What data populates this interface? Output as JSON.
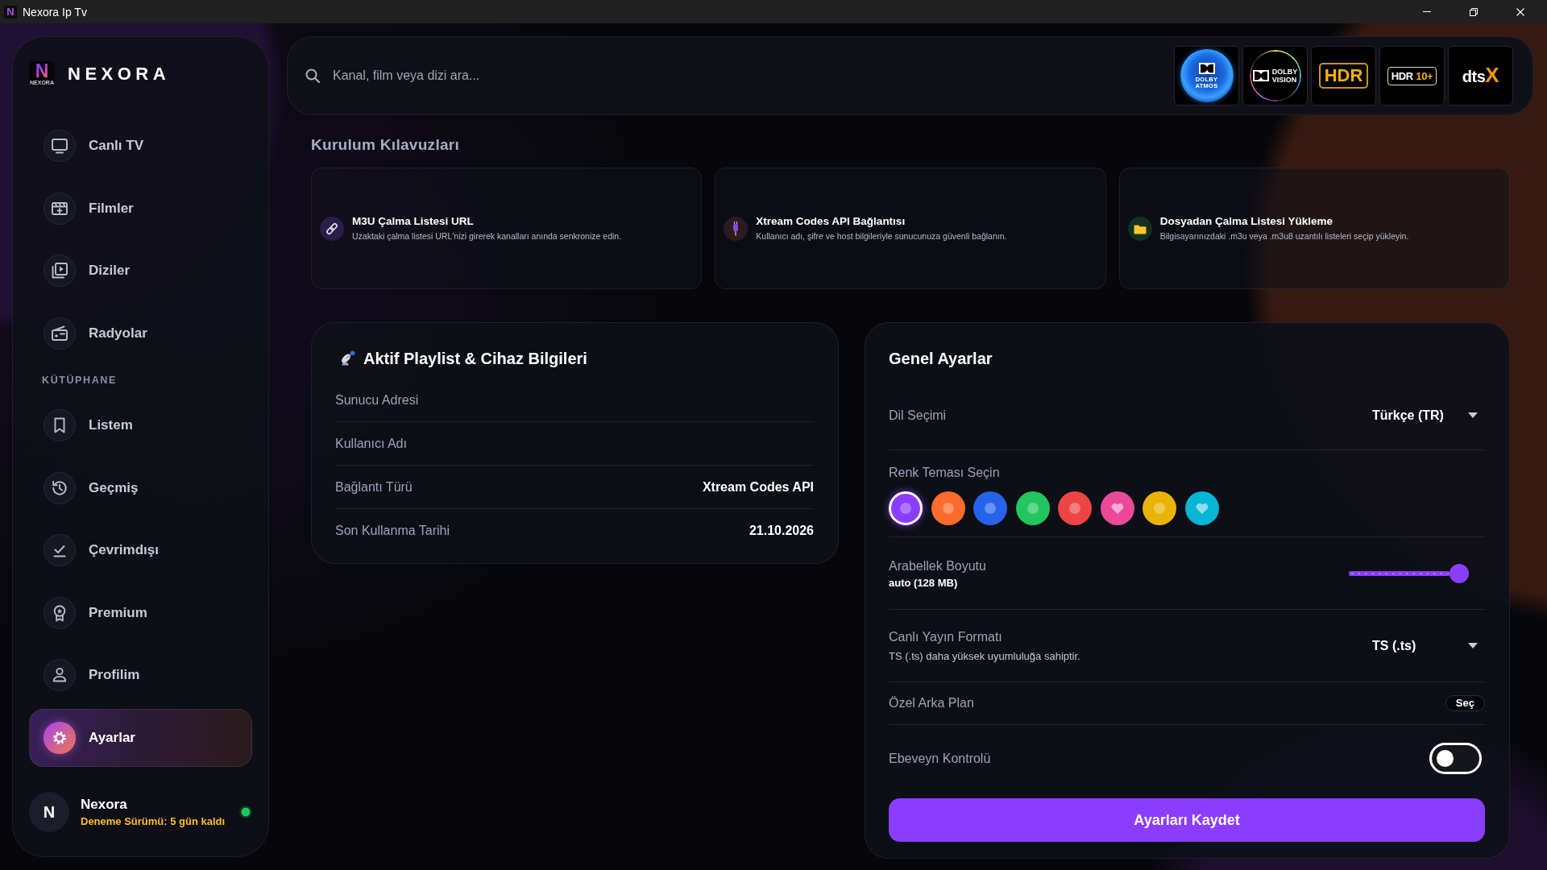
{
  "window": {
    "title": "Nexora Ip Tv",
    "icon_letter": "N"
  },
  "sidebar": {
    "logo": {
      "letter": "N",
      "caption": "NEXORA"
    },
    "brand": "NEXORA",
    "items": [
      {
        "label": "Canlı TV",
        "selected": false
      },
      {
        "label": "Filmler",
        "selected": false
      },
      {
        "label": "Diziler",
        "selected": false
      },
      {
        "label": "Radyolar",
        "selected": false
      }
    ],
    "section_label": "KÜTÜPHANE",
    "library_items": [
      {
        "label": "Listem",
        "selected": false
      },
      {
        "label": "Geçmiş",
        "selected": false
      },
      {
        "label": "Çevrimdışı",
        "selected": false
      },
      {
        "label": "Premium",
        "selected": false
      },
      {
        "label": "Profilim",
        "selected": false
      },
      {
        "label": "Ayarlar",
        "selected": true
      }
    ],
    "user": {
      "initial": "N",
      "name": "Nexora",
      "status": "Deneme Sürümü: 5 gün kaldı",
      "online": true
    }
  },
  "search": {
    "placeholder": "Kanal, film veya dizi ara..."
  },
  "format_logos": [
    {
      "kind": "atmos",
      "lines": [
        "DOLBY",
        "ATMOS"
      ]
    },
    {
      "kind": "vision",
      "lines": [
        "DOLBY",
        "VISION"
      ]
    },
    {
      "kind": "hdr",
      "lines": [
        "HDR"
      ]
    },
    {
      "kind": "hdr10",
      "lines": [
        "HDR",
        "10+"
      ]
    },
    {
      "kind": "dtsx",
      "lines": [
        "dts",
        "X"
      ]
    }
  ],
  "guides": {
    "title": "Kurulum Kılavuzları",
    "cards": [
      {
        "title": "M3U Çalma Listesi URL",
        "description": "Uzaktaki çalma listesi URL'nizi girerek kanalları anında senkronize edin."
      },
      {
        "title": "Xtream Codes API Bağlantısı",
        "description": "Kullanıcı adı, şifre ve host bilgileriyle sunucunuza güvenli bağlanın."
      },
      {
        "title": "Dosyadan Çalma Listesi Yükleme",
        "description": "Bilgisayarınızdaki .m3u veya .m3u8 uzantılı listeleri seçip yükleyin."
      }
    ]
  },
  "playlist_info": {
    "title": "Aktif Playlist & Cihaz Bilgileri",
    "rows": [
      {
        "label": "Sunucu Adresi"
      },
      {
        "label": "Kullanıcı Adı"
      },
      {
        "label": "Bağlantı Türü",
        "value": "Xtream Codes API"
      },
      {
        "label": "Son Kullanma Tarihi",
        "value": "21.10.2026"
      }
    ]
  },
  "settings": {
    "title": "Genel Ayarlar",
    "rows": [
      {
        "kind": "select",
        "label": "Dil Seçimi",
        "value": "Türkçe (TR)"
      },
      {
        "kind": "swatches",
        "label": "Renk Teması Seçin",
        "swatches": [
          {
            "kind": "dot",
            "color": "#8b3dff",
            "selected": true
          },
          {
            "kind": "dot",
            "color": "#ff6b2c",
            "selected": false
          },
          {
            "kind": "dot",
            "color": "#2563eb",
            "selected": false
          },
          {
            "kind": "dot",
            "color": "#22c55e",
            "selected": false
          },
          {
            "kind": "dot",
            "color": "#ef4444",
            "selected": false
          },
          {
            "kind": "heart",
            "color": "#ec4899",
            "selected": false
          },
          {
            "kind": "dot",
            "color": "#eab308",
            "selected": false
          },
          {
            "kind": "heart",
            "color": "#06b6d4",
            "selected": false
          }
        ]
      },
      {
        "kind": "slider",
        "label": "Arabellek Boyutu",
        "reading": "auto (128 MB)",
        "level": 1
      },
      {
        "kind": "select",
        "label": "Canlı Yayın Formatı",
        "description": "TS (.ts) daha yüksek uyumluluğa sahiptir.",
        "value": "TS (.ts)"
      },
      {
        "kind": "button",
        "label": "Özel Arka Plan",
        "button": "Seç"
      },
      {
        "kind": "toggle",
        "label": "Ebeveyn Kontrolü",
        "on": false
      }
    ],
    "save_button": "Ayarları Kaydet"
  }
}
